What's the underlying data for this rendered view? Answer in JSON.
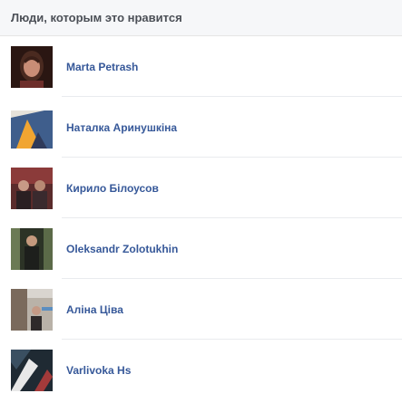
{
  "dialog": {
    "title": "Люди, которым это нравится"
  },
  "people": [
    {
      "name": "Marta Petrash",
      "avatar": "woman-portrait-photo"
    },
    {
      "name": "Наталка Аринушкіна",
      "avatar": "sunset-landscape-photo"
    },
    {
      "name": "Кирило Білоусов",
      "avatar": "group-photo"
    },
    {
      "name": "Oleksandr Zolotukhin",
      "avatar": "man-standing-photo"
    },
    {
      "name": "Аліна Ціва",
      "avatar": "street-photo"
    },
    {
      "name": "Varlivoka Hs",
      "avatar": "abstract-art-photo"
    }
  ],
  "colors": {
    "link": "#365899",
    "header_bg": "#f6f7f9",
    "header_text": "#4b4f56"
  }
}
